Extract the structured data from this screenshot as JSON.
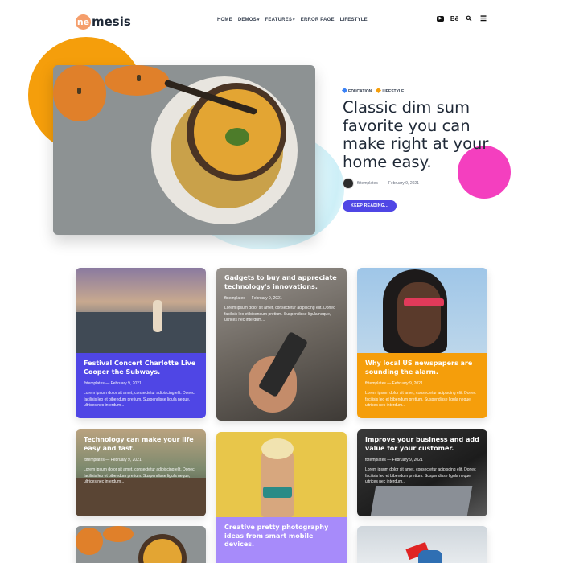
{
  "brand": {
    "badge": "ne",
    "name": "mesis"
  },
  "nav": {
    "items": [
      {
        "label": "HOME",
        "has_dropdown": false
      },
      {
        "label": "DEMOS",
        "has_dropdown": true
      },
      {
        "label": "FEATURES",
        "has_dropdown": true
      },
      {
        "label": "ERROR PAGE",
        "has_dropdown": false
      },
      {
        "label": "LIFESTYLE",
        "has_dropdown": false
      }
    ],
    "dropdown_glyph": "▾",
    "tools": [
      {
        "icon": "youtube-icon",
        "glyph": "▶"
      },
      {
        "icon": "behance-icon",
        "glyph": "Bē"
      },
      {
        "icon": "search-icon",
        "glyph": "⚲"
      },
      {
        "icon": "menu-icon",
        "glyph": "☰"
      }
    ]
  },
  "hero": {
    "tags": [
      {
        "label": "EDUCATION",
        "color": "#3b82f6"
      },
      {
        "label": "LIFESTYLE",
        "color": "#f59e0b"
      }
    ],
    "title": "Classic dim sum favorite you can make right at your home easy.",
    "author": "fbtemplates",
    "separator": "—",
    "date": "February 9, 2021",
    "button": "KEEP READING..."
  },
  "excerpt": "Lorem ipsum dolor sit amet, consectetur adipiscing elit. Donec facilisis leo et bibendum pretium. Suspendisse ligula neque, ultrices nec interdum...",
  "cards": [
    {
      "title": "Festival Concert Charlotte Live Cooper the Subways.",
      "author": "fbtemplates",
      "date": "February 9, 2021",
      "excerpt": "Lorem ipsum dolor sit amet, consectetur adipiscing elit. Donec facilisis leo et bibendum pretium. Suspendisse ligula neque, ultrices nec interdum..."
    },
    {
      "title": "Gadgets to buy and appreciate technology's innovations.",
      "author": "fbtemplates",
      "date": "February 9, 2021",
      "excerpt": "Lorem ipsum dolor sit amet, consectetur adipiscing elit. Donec facilisis leo et bibendum pretium. Suspendisse ligula neque, ultrices nec interdum..."
    },
    {
      "title": "Why local US newspapers are sounding the alarm.",
      "author": "fbtemplates",
      "date": "February 9, 2021",
      "excerpt": "Lorem ipsum dolor sit amet, consectetur adipiscing elit. Donec facilisis leo et bibendum pretium. Suspendisse ligula neque, ultrices nec interdum..."
    },
    {
      "title": "Technology can make your life easy and fast.",
      "author": "fbtemplates",
      "date": "February 9, 2021",
      "excerpt": "Lorem ipsum dolor sit amet, consectetur adipiscing elit. Donec facilisis leo et bibendum pretium. Suspendisse ligula neque, ultrices nec interdum..."
    },
    {
      "title": "Creative pretty photography ideas from smart mobile devices.",
      "author": "",
      "date": "",
      "excerpt": ""
    },
    {
      "title": "Improve your business and add value for your customer.",
      "author": "fbtemplates",
      "date": "February 9, 2021",
      "excerpt": "Lorem ipsum dolor sit amet, consectetur adipiscing elit. Donec facilisis leo et bibendum pretium. Suspendisse ligula neque, ultrices nec interdum..."
    }
  ],
  "colors": {
    "accent": "#4f46e5",
    "orange": "#f59e0b",
    "pink": "#f43fbf",
    "lavender": "#a78bfa"
  }
}
